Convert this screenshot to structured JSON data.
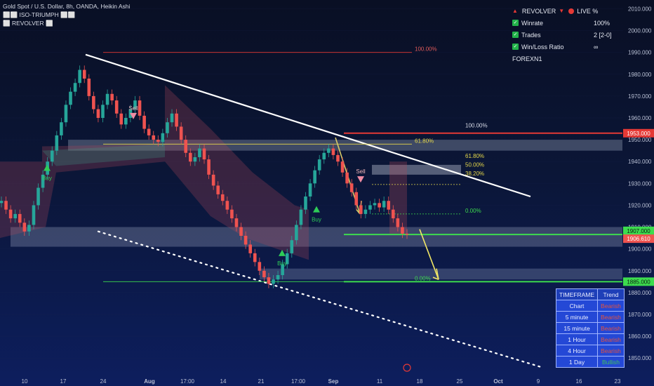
{
  "header": {
    "title": "Gold Spot / U.S. Dollar, 8h, OANDA, Heikin Ashi",
    "indicator_1": "⬜⬜ ISO-TRIUMPH ⬜⬜",
    "indicator_2": "⬜ REVOLVER ⬜"
  },
  "stats_panel": {
    "title": "REVOLVER",
    "live_label": "LIVE %",
    "rows": [
      {
        "label": "Winrate",
        "value": "100%"
      },
      {
        "label": "Trades",
        "value": "2 [2-0]"
      },
      {
        "label": "Win/Loss Ratio",
        "value": "∞"
      }
    ],
    "footer": "FOREXN1"
  },
  "timeframe_table": {
    "headers": [
      "TIMEFRAME",
      "Trend"
    ],
    "rows": [
      {
        "tf": "Chart",
        "trend": "Bearish"
      },
      {
        "tf": "5 minute",
        "trend": "Bearish"
      },
      {
        "tf": "15 minute",
        "trend": "Bearish"
      },
      {
        "tf": "1 Hour",
        "trend": "Bearish"
      },
      {
        "tf": "4 Hour",
        "trend": "Bearish"
      },
      {
        "tf": "1 Day",
        "trend": "Bullish"
      }
    ]
  },
  "colors": {
    "bull": "#26a69a",
    "bear": "#ef5350",
    "trendline": "#ffffff",
    "fib_yellow": "#e6d84a",
    "level_green": "#3ddc4e",
    "level_red": "#e53935"
  },
  "chart_data": {
    "type": "candlestick",
    "title": "Gold Spot / U.S. Dollar, 8h, OANDA, Heikin Ashi",
    "ylim": [
      1843,
      2014
    ],
    "y_ticks": [
      1850,
      1860,
      1870,
      1880,
      1890,
      1900,
      1910,
      1920,
      1930,
      1940,
      1950,
      1960,
      1970,
      1980,
      1990,
      2000,
      2010
    ],
    "y_tick_labels": [
      "1850.000",
      "1860.000",
      "1870.000",
      "1880.000",
      "1890.000",
      "1900.000",
      "1910.000",
      "1920.000",
      "1930.000",
      "1940.000",
      "1950.000",
      "1960.000",
      "1970.000",
      "1980.000",
      "1990.000",
      "2000.000",
      "2010.000"
    ],
    "x_tick_labels": [
      "10",
      "17",
      "24",
      "Aug",
      "17:00",
      "14",
      "21",
      "17:00",
      "Sep",
      "11",
      "18",
      "25",
      "Oct",
      "9",
      "16",
      "23"
    ],
    "price_tags": [
      {
        "value": 1953.0,
        "label": "1953.000",
        "color": "#e53935"
      },
      {
        "value": 1907.0,
        "label": "1907.000",
        "color": "#3ddc4e"
      },
      {
        "value": 1906.61,
        "label": "1906.610",
        "color": "#ef5350"
      },
      {
        "value": 1885.0,
        "label": "1885.000",
        "color": "#3ddc4e"
      }
    ],
    "fib_labels": [
      {
        "label": "100.00%",
        "value": 1990
      },
      {
        "label": "61.80%",
        "value": 1948
      },
      {
        "label": "0.00%",
        "value": 1885
      },
      {
        "label": "100.00%",
        "value": 1955
      },
      {
        "label": "61.80%",
        "value": 1941
      },
      {
        "label": "50.00%",
        "value": 1937
      },
      {
        "label": "38.20%",
        "value": 1933
      },
      {
        "label": "0.00%",
        "value": 1916
      }
    ],
    "signals": [
      {
        "label": "Buy",
        "type": "buy"
      },
      {
        "label": "Sell",
        "type": "sell"
      },
      {
        "label": "Buy",
        "type": "buy"
      },
      {
        "label": "Buy",
        "type": "buy"
      },
      {
        "label": "Sell",
        "type": "sell"
      }
    ],
    "series": [
      {
        "values": [
          1922,
          1918,
          1914,
          1916,
          1912,
          1908,
          1911,
          1920,
          1928,
          1934,
          1940,
          1945,
          1952,
          1958,
          1966,
          1972,
          1976,
          1982,
          1978,
          1970,
          1964,
          1960,
          1966,
          1971,
          1968,
          1962,
          1957,
          1960,
          1964,
          1968,
          1961,
          1955,
          1952,
          1950,
          1949,
          1953,
          1958,
          1962,
          1956,
          1950,
          1944,
          1940,
          1942,
          1946,
          1941,
          1934,
          1929,
          1925,
          1922,
          1918,
          1914,
          1910,
          1906,
          1902,
          1898,
          1894,
          1890,
          1887,
          1884,
          1886,
          1888,
          1893,
          1898,
          1904,
          1911,
          1918,
          1924,
          1930,
          1936,
          1941,
          1944,
          1946,
          1943,
          1940,
          1935,
          1930,
          1926,
          1920,
          1916,
          1918,
          1920,
          1921,
          1919,
          1922,
          1918,
          1914,
          1910,
          1907,
          1906.61
        ]
      }
    ]
  }
}
